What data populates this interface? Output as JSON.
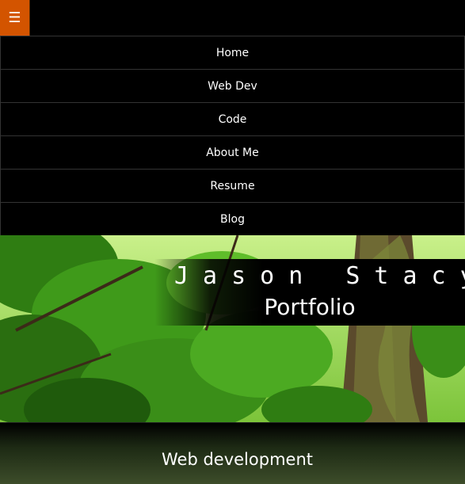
{
  "header": {
    "menu_icon": "hamburger-icon",
    "menu_glyph": "☰",
    "accent_color": "#d35400"
  },
  "nav": {
    "items": [
      {
        "label": "Home"
      },
      {
        "label": "Web Dev"
      },
      {
        "label": "Code"
      },
      {
        "label": "About Me"
      },
      {
        "label": "Resume"
      },
      {
        "label": "Blog"
      }
    ]
  },
  "hero": {
    "name": "Jason Stacy",
    "subtitle": "Portfolio"
  },
  "section": {
    "heading": "Web development"
  }
}
